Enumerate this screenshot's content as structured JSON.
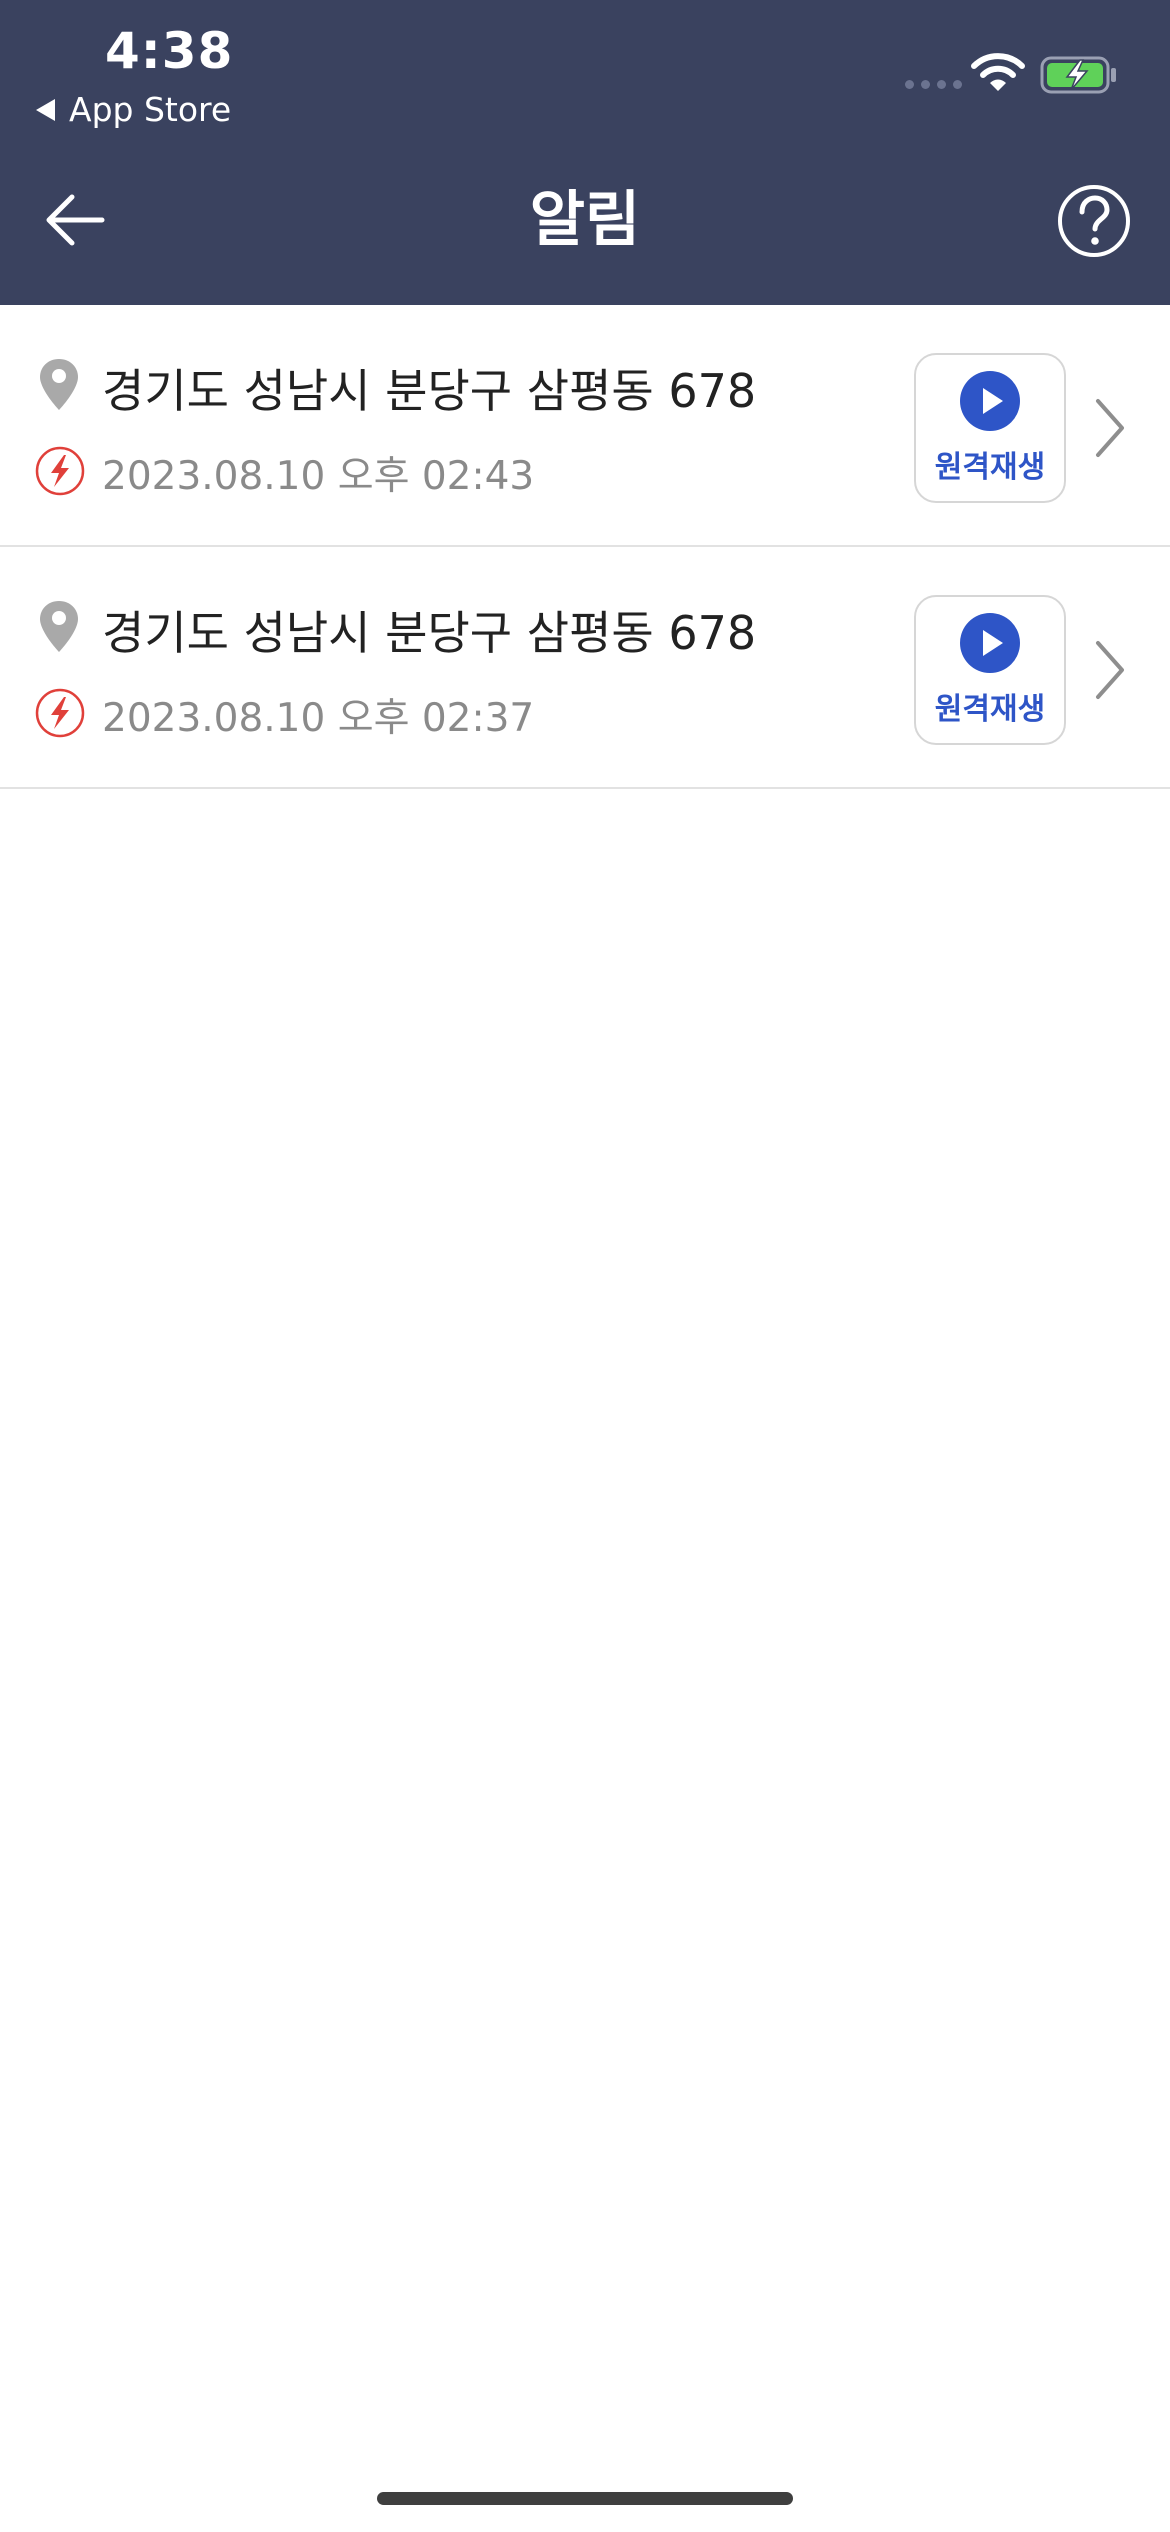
{
  "status_bar": {
    "time": "4:38",
    "back_app_label": "App Store",
    "battery_color": "#5fd159"
  },
  "header": {
    "title": "알림",
    "back_icon": "arrow-left-icon",
    "help_icon": "question-circle-icon"
  },
  "notifications": [
    {
      "address": "경기도 성남시 분당구 삼평동 678",
      "datetime": "2023.08.10 오후 02:43",
      "play_label": "원격재생"
    },
    {
      "address": "경기도 성남시 분당구 삼평동 678",
      "datetime": "2023.08.10 오후 02:37",
      "play_label": "원격재생"
    }
  ],
  "colors": {
    "header_bg": "#3a425f",
    "accent_blue": "#2e55c7",
    "alert_red": "#e0403a"
  }
}
